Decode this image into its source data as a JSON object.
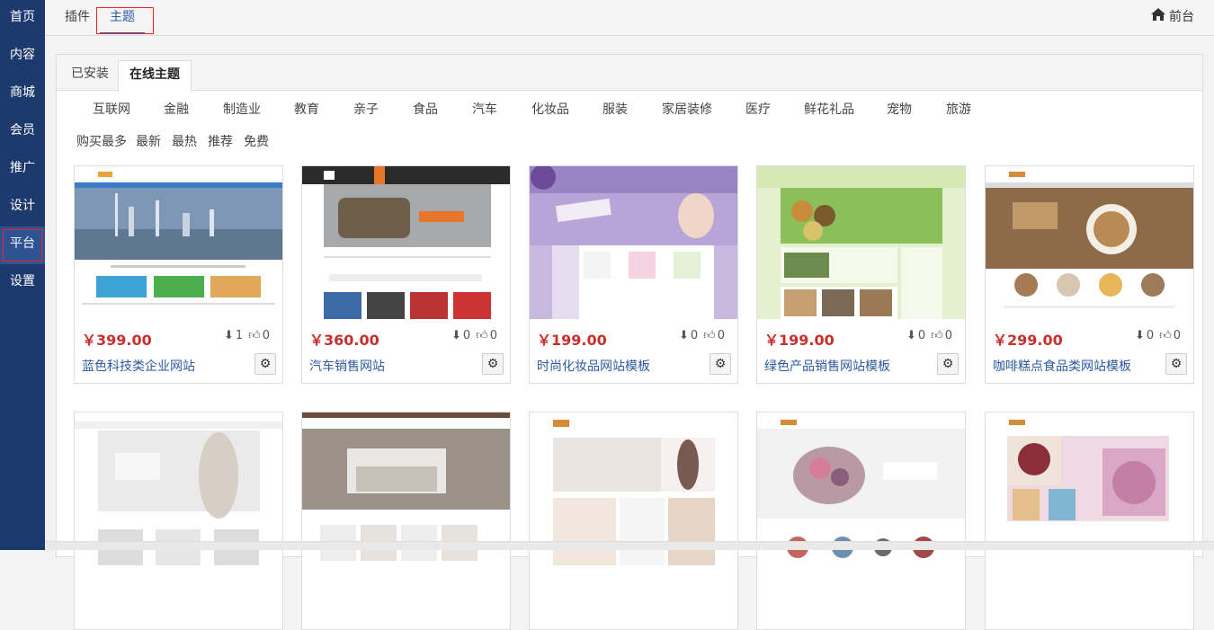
{
  "sidebar": {
    "items": [
      "首页",
      "内容",
      "商城",
      "会员",
      "推广",
      "设计",
      "平台",
      "设置"
    ]
  },
  "topbar": {
    "tab_plugins": "插件",
    "tab_themes": "主题",
    "front_label": "前台"
  },
  "panel": {
    "tab_installed": "已安装",
    "tab_online": "在线主题",
    "categories": [
      "互联网",
      "金融",
      "制造业",
      "教育",
      "亲子",
      "食品",
      "汽车",
      "化妆品",
      "服装",
      "家居装修",
      "医疗",
      "鲜花礼品",
      "宠物",
      "旅游"
    ],
    "sorts": [
      "购买最多",
      "最新",
      "最热",
      "推荐",
      "免费"
    ]
  },
  "cards": [
    {
      "price": "￥399.00",
      "downloads": "1",
      "likes": "0",
      "name": "蓝色科技类企业网站"
    },
    {
      "price": "￥360.00",
      "downloads": "0",
      "likes": "0",
      "name": "汽车销售网站"
    },
    {
      "price": "￥199.00",
      "downloads": "0",
      "likes": "0",
      "name": "时尚化妆品网站模板"
    },
    {
      "price": "￥199.00",
      "downloads": "0",
      "likes": "0",
      "name": "绿色产品销售网站模板"
    },
    {
      "price": "￥299.00",
      "downloads": "0",
      "likes": "0",
      "name": "咖啡糕点食品类网站模板"
    }
  ],
  "colors": {
    "sidebar_bg": "#1d3a6e",
    "price": "#c9302c",
    "link": "#2b5aa0"
  }
}
